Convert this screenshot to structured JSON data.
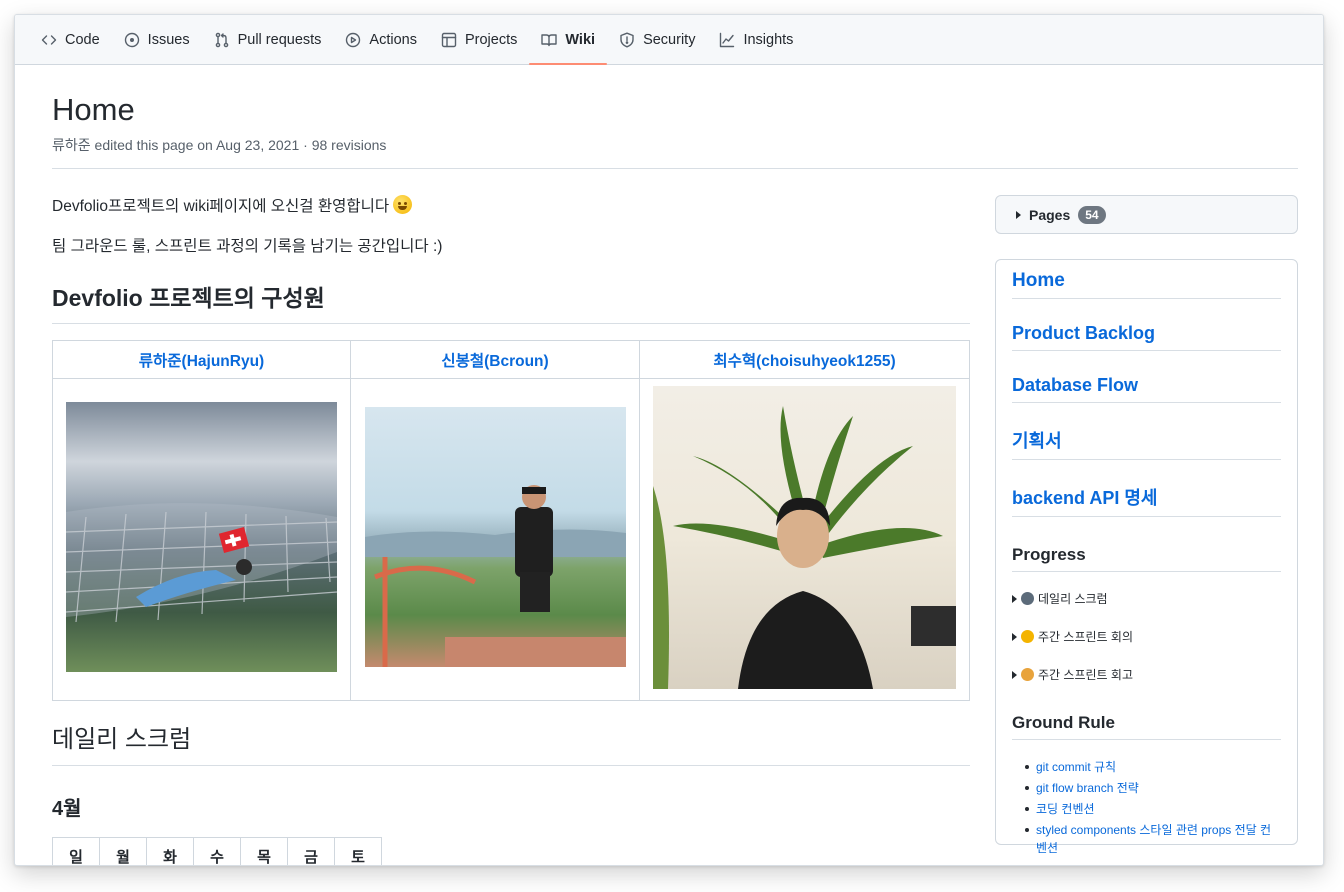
{
  "nav": {
    "tabs": [
      {
        "label": "Code",
        "icon": "code-icon"
      },
      {
        "label": "Issues",
        "icon": "issue-icon"
      },
      {
        "label": "Pull requests",
        "icon": "pull-request-icon"
      },
      {
        "label": "Actions",
        "icon": "play-icon"
      },
      {
        "label": "Projects",
        "icon": "table-icon"
      },
      {
        "label": "Wiki",
        "icon": "book-icon",
        "active": true
      },
      {
        "label": "Security",
        "icon": "shield-icon"
      },
      {
        "label": "Insights",
        "icon": "graph-icon"
      }
    ],
    "active_color": "#fd8c73"
  },
  "page": {
    "title": "Home",
    "meta": "류하준 edited this page on Aug 23, 2021 · 98 revisions"
  },
  "content": {
    "intro1": "Devfolio프로젝트의 wiki페이지에 오신걸 환영합니다",
    "intro2": "팀 그라운드 룰, 스프린트 과정의 기록을 남기는 공간입니다 :)",
    "members_heading": "Devfolio 프로젝트의 구성원",
    "members": [
      {
        "name": "류하준(HajunRyu)"
      },
      {
        "name": "신봉철(Bcroun)"
      },
      {
        "name": "최수혁(choisuhyeok1255)"
      }
    ],
    "scrum_heading": "데일리 스크럼",
    "month": "4월",
    "weekdays": [
      "일",
      "월",
      "화",
      "수",
      "목",
      "금",
      "토"
    ]
  },
  "sidebar": {
    "pages_label": "Pages",
    "pages_count": "54",
    "links": [
      "Home",
      "Product Backlog",
      "Database Flow",
      "기획서",
      "backend API 명세"
    ],
    "progress_heading": "Progress",
    "progress_items": [
      {
        "label": "데일리 스크럼",
        "icon": "speaking-head-icon"
      },
      {
        "label": "주간 스프린트 회의",
        "icon": "raising-hand-icon"
      },
      {
        "label": "주간 스프린트 회고",
        "icon": "person-icon"
      }
    ],
    "ground_rule_heading": "Ground Rule",
    "ground_rules": [
      "git commit 규칙",
      "git flow branch 전략",
      "코딩 컨벤션",
      "styled components 스타일 관련 props 전달 컨벤션"
    ]
  },
  "colors": {
    "link": "#0969da",
    "text": "#24292f",
    "muted": "#57606a",
    "border": "#d0d7de"
  }
}
